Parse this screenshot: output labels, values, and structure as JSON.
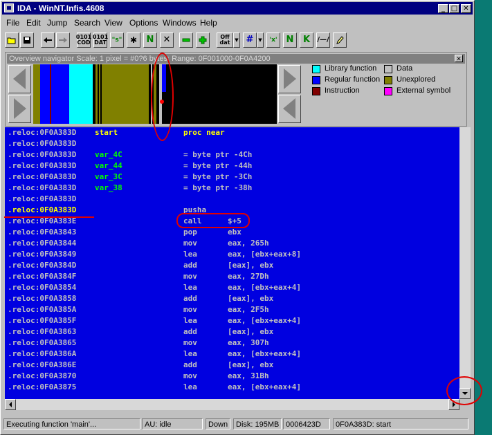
{
  "window": {
    "title": "IDA - WinNT.Infis.4608"
  },
  "title_buttons": {
    "minimize": "_",
    "maximize": "□",
    "close": "✕"
  },
  "menu": [
    "File",
    "Edit",
    "Jump",
    "Search",
    "View",
    "Options",
    "Windows",
    "Help"
  ],
  "toolbar": {
    "code_label_top": "0101",
    "code_label_bottom": "COD",
    "data_label_top": "0101",
    "data_label_bottom": "DAT",
    "string_label": "\"s\"",
    "offset_label_top": "Off",
    "offset_label_bottom": "dat",
    "hex_label": "'x'",
    "n_label": "N",
    "k_label": "K"
  },
  "navigator": {
    "title": "Overview navigator Scale: 1 pixel = #0?6 bytes; Range: 0F001000-0F0A4200",
    "close": "✕",
    "legend": [
      {
        "label": "Library function",
        "color": "#00ffff"
      },
      {
        "label": "Data",
        "color": "#c0c0c0"
      },
      {
        "label": "Regular function",
        "color": "#0000ff"
      },
      {
        "label": "Unexplored",
        "color": "#808000"
      },
      {
        "label": "Instruction",
        "color": "#800000"
      },
      {
        "label": "External symbol",
        "color": "#ff00ff"
      }
    ]
  },
  "disasm": [
    {
      "addr": ".reloc:0F0A383D",
      "label": "start",
      "mnemonic": "proc near",
      "operand": "",
      "label_class": "start",
      "mn_class": "yel"
    },
    {
      "addr": ".reloc:0F0A383D",
      "label": "",
      "mnemonic": "",
      "operand": ""
    },
    {
      "addr": ".reloc:0F0A383D",
      "label": "var_4C",
      "mnemonic": "= byte ptr -4Ch",
      "operand": ""
    },
    {
      "addr": ".reloc:0F0A383D",
      "label": "var_44",
      "mnemonic": "= byte ptr -44h",
      "operand": ""
    },
    {
      "addr": ".reloc:0F0A383D",
      "label": "var_3C",
      "mnemonic": "= byte ptr -3Ch",
      "operand": ""
    },
    {
      "addr": ".reloc:0F0A383D",
      "label": "var_38",
      "mnemonic": "= byte ptr -38h",
      "operand": ""
    },
    {
      "addr": ".reloc:0F0A383D",
      "label": "",
      "mnemonic": "",
      "operand": ""
    },
    {
      "addr": ".reloc:0F0A383D",
      "label": "",
      "mnemonic": "pusha",
      "operand": "",
      "addr_yellow": true
    },
    {
      "addr": ".reloc:0F0A383E",
      "label": "",
      "mnemonic": "call",
      "operand": "$+5"
    },
    {
      "addr": ".reloc:0F0A3843",
      "label": "",
      "mnemonic": "pop",
      "operand": "ebx"
    },
    {
      "addr": ".reloc:0F0A3844",
      "label": "",
      "mnemonic": "mov",
      "operand": "eax, 265h"
    },
    {
      "addr": ".reloc:0F0A3849",
      "label": "",
      "mnemonic": "lea",
      "operand": "eax, [ebx+eax+8]"
    },
    {
      "addr": ".reloc:0F0A384D",
      "label": "",
      "mnemonic": "add",
      "operand": "[eax], ebx"
    },
    {
      "addr": ".reloc:0F0A384F",
      "label": "",
      "mnemonic": "mov",
      "operand": "eax, 27Dh"
    },
    {
      "addr": ".reloc:0F0A3854",
      "label": "",
      "mnemonic": "lea",
      "operand": "eax, [ebx+eax+4]"
    },
    {
      "addr": ".reloc:0F0A3858",
      "label": "",
      "mnemonic": "add",
      "operand": "[eax], ebx"
    },
    {
      "addr": ".reloc:0F0A385A",
      "label": "",
      "mnemonic": "mov",
      "operand": "eax, 2F5h"
    },
    {
      "addr": ".reloc:0F0A385F",
      "label": "",
      "mnemonic": "lea",
      "operand": "eax, [ebx+eax+4]"
    },
    {
      "addr": ".reloc:0F0A3863",
      "label": "",
      "mnemonic": "add",
      "operand": "[eax], ebx"
    },
    {
      "addr": ".reloc:0F0A3865",
      "label": "",
      "mnemonic": "mov",
      "operand": "eax, 307h"
    },
    {
      "addr": ".reloc:0F0A386A",
      "label": "",
      "mnemonic": "lea",
      "operand": "eax, [ebx+eax+4]"
    },
    {
      "addr": ".reloc:0F0A386E",
      "label": "",
      "mnemonic": "add",
      "operand": "[eax], ebx"
    },
    {
      "addr": ".reloc:0F0A3870",
      "label": "",
      "mnemonic": "mov",
      "operand": "eax, 31Bh"
    },
    {
      "addr": ".reloc:0F0A3875",
      "label": "",
      "mnemonic": "lea",
      "operand": "eax, [ebx+eax+4]"
    }
  ],
  "status": {
    "message": "Executing function 'main'...",
    "au": "AU:  idle",
    "direction": "Down",
    "disk": "Disk: 195MB",
    "offset": "0006423D",
    "location": "0F0A383D: start"
  },
  "colors": {
    "disasm_bg": "#0000e0",
    "title_bg": "#000080",
    "annotation": "#e00000"
  }
}
